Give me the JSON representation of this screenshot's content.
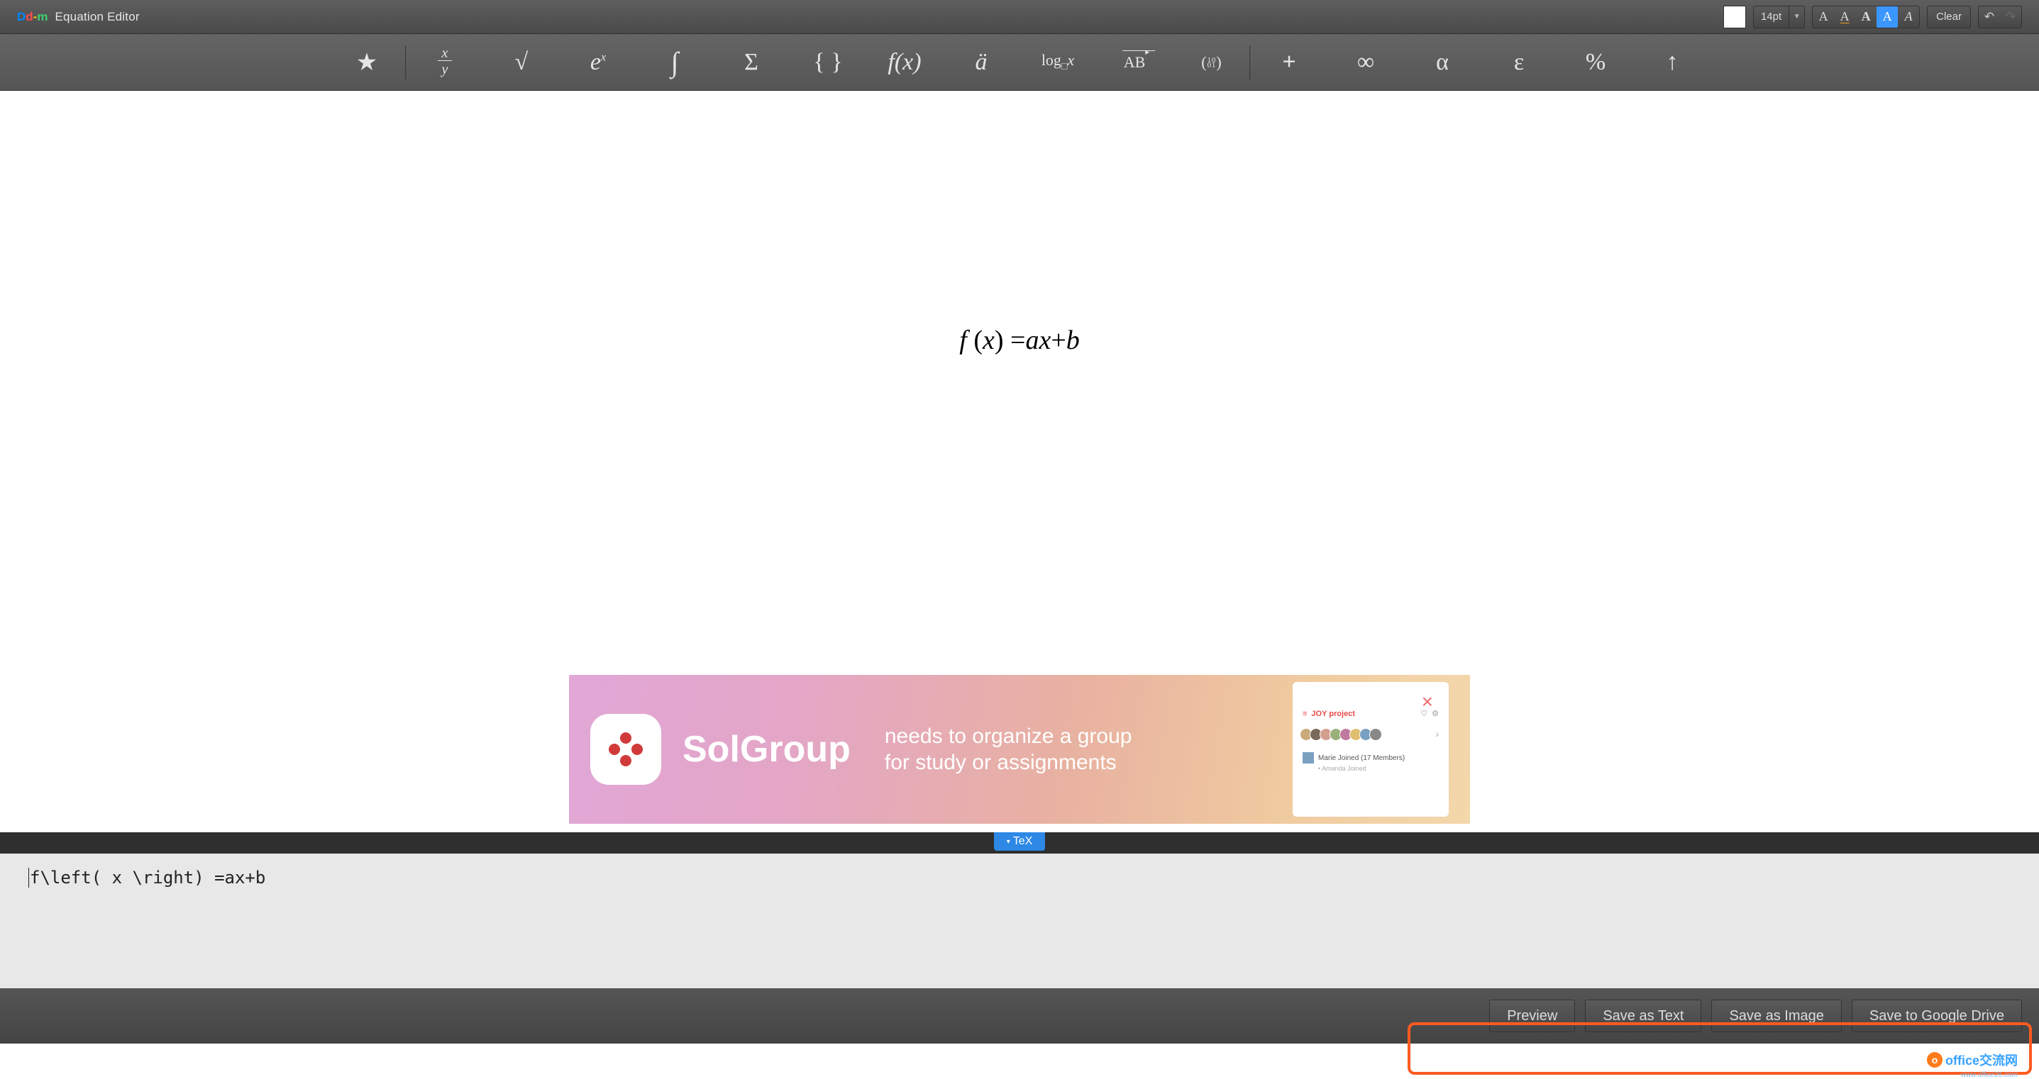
{
  "header": {
    "title": "Equation Editor",
    "font_size": "14pt",
    "clear_label": "Clear"
  },
  "toolbar": {
    "items": [
      {
        "id": "favorites",
        "name": "favorites-icon"
      },
      {
        "id": "fraction",
        "name": "fraction-icon"
      },
      {
        "id": "root",
        "name": "root-icon"
      },
      {
        "id": "exponent",
        "name": "exponent-icon"
      },
      {
        "id": "integral",
        "name": "integral-icon"
      },
      {
        "id": "summation",
        "name": "summation-icon"
      },
      {
        "id": "brackets",
        "name": "brackets-icon"
      },
      {
        "id": "function",
        "name": "function-icon"
      },
      {
        "id": "accent",
        "name": "accent-icon"
      },
      {
        "id": "log",
        "name": "log-icon"
      },
      {
        "id": "vector",
        "name": "vector-icon"
      },
      {
        "id": "matrix",
        "name": "matrix-icon"
      },
      {
        "id": "plus",
        "name": "plus-icon"
      },
      {
        "id": "infinity",
        "name": "infinity-icon"
      },
      {
        "id": "alpha",
        "name": "alpha-icon"
      },
      {
        "id": "epsilon",
        "name": "epsilon-icon"
      },
      {
        "id": "percent",
        "name": "percent-icon"
      },
      {
        "id": "arrow-up",
        "name": "arrow-up-icon"
      }
    ]
  },
  "style_btns": {
    "a1": "A",
    "a2": "A",
    "a3": "A",
    "a4": "A",
    "a5": "A"
  },
  "equation_rendered": {
    "f": "f",
    "x": "x",
    "a": "a",
    "b": "b"
  },
  "ad": {
    "brand": "SolGroup",
    "line1": "needs to organize a group",
    "line2": "for study or assignments",
    "preview_title": "JOY project",
    "marie": "Marie Joined (17 Members)",
    "amanda": "Amanda Joined"
  },
  "tex": {
    "tab_label": "TeX",
    "source": "f\\left( x \\right) =ax+b"
  },
  "footer": {
    "preview": "Preview",
    "save_text": "Save as Text",
    "save_image": "Save as Image",
    "save_gdrive": "Save to Google Drive"
  },
  "watermark": {
    "text": "office交流网",
    "url": "www.office26.com"
  },
  "colors": {
    "accent": "#2d88e6",
    "highlight": "#ff5a1f"
  }
}
